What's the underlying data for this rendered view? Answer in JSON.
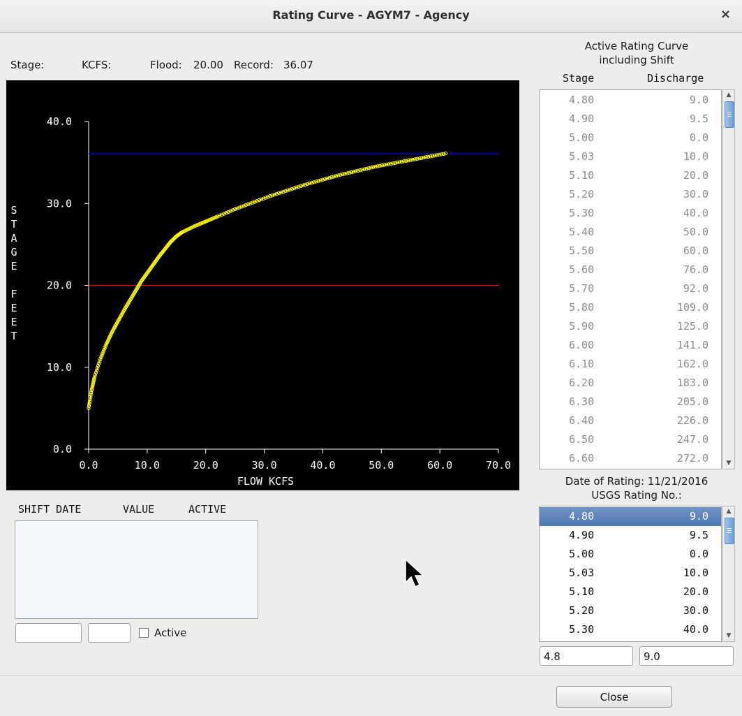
{
  "window": {
    "title": "Rating Curve - AGYM7 - Agency",
    "close_glyph": "×"
  },
  "info_bar": {
    "stage_label": "Stage:",
    "kcfs_label": "KCFS:",
    "flood_label": "Flood:",
    "flood_value": "20.00",
    "record_label": "Record:",
    "record_value": "36.07"
  },
  "chart_data": {
    "type": "line",
    "xlabel": "FLOW KCFS",
    "ylabel": "STAGE FEET",
    "xlim": [
      0,
      70
    ],
    "ylim": [
      0,
      40
    ],
    "x_ticks": [
      "0.0",
      "10.0",
      "20.0",
      "30.0",
      "40.0",
      "50.0",
      "60.0",
      "70.0"
    ],
    "y_ticks": [
      "0.0",
      "10.0",
      "20.0",
      "30.0",
      "40.0"
    ],
    "series": [
      {
        "color": "#ffff00",
        "marker": "circle",
        "x": [
          0,
          0.5,
          1.0,
          2.0,
          3.0,
          4.0,
          5.0,
          6.0,
          7.0,
          8.0,
          9.0,
          10.0,
          11.0,
          12.0,
          13.0,
          14.0,
          15.0,
          16.0,
          18.0,
          20.0,
          22.0,
          25.0,
          28.0,
          31.0,
          34.0,
          37.0,
          40.0,
          43.0,
          46.0,
          49.0,
          52.0,
          55.0,
          58.0,
          61.0
        ],
        "y": [
          5.0,
          7.2,
          8.8,
          11.0,
          12.8,
          14.3,
          15.6,
          16.9,
          18.1,
          19.3,
          20.5,
          21.5,
          22.5,
          23.5,
          24.4,
          25.3,
          26.0,
          26.5,
          27.2,
          27.8,
          28.4,
          29.3,
          30.1,
          30.9,
          31.6,
          32.3,
          32.9,
          33.5,
          34.0,
          34.5,
          34.9,
          35.3,
          35.7,
          36.1
        ]
      }
    ],
    "reference_lines": [
      {
        "name": "Record",
        "y": 36.07,
        "color": "#0000ff"
      },
      {
        "name": "Flood",
        "y": 20.0,
        "color": "#ff0000"
      }
    ]
  },
  "active_curve": {
    "title_line1": "Active Rating Curve",
    "title_line2": "including Shift",
    "col_stage": "Stage",
    "col_discharge": "Discharge",
    "rows": [
      [
        "4.80",
        "9.0"
      ],
      [
        "4.90",
        "9.5"
      ],
      [
        "5.00",
        "0.0"
      ],
      [
        "5.03",
        "10.0"
      ],
      [
        "5.10",
        "20.0"
      ],
      [
        "5.20",
        "30.0"
      ],
      [
        "5.30",
        "40.0"
      ],
      [
        "5.40",
        "50.0"
      ],
      [
        "5.50",
        "60.0"
      ],
      [
        "5.60",
        "76.0"
      ],
      [
        "5.70",
        "92.0"
      ],
      [
        "5.80",
        "109.0"
      ],
      [
        "5.90",
        "125.0"
      ],
      [
        "6.00",
        "141.0"
      ],
      [
        "6.10",
        "162.0"
      ],
      [
        "6.20",
        "183.0"
      ],
      [
        "6.30",
        "205.0"
      ],
      [
        "6.40",
        "226.0"
      ],
      [
        "6.50",
        "247.0"
      ],
      [
        "6.60",
        "272.0"
      ]
    ]
  },
  "usgs_rating": {
    "date_line": "Date of Rating: 11/21/2016",
    "rating_no_line": "USGS Rating No.:",
    "rows": [
      [
        "4.80",
        "9.0"
      ],
      [
        "4.90",
        "9.5"
      ],
      [
        "5.00",
        "0.0"
      ],
      [
        "5.03",
        "10.0"
      ],
      [
        "5.10",
        "20.0"
      ],
      [
        "5.20",
        "30.0"
      ],
      [
        "5.30",
        "40.0"
      ]
    ],
    "selected_index": 0,
    "stage_input": "4.8",
    "discharge_input": "9.0"
  },
  "shift": {
    "col_date": "SHIFT DATE",
    "col_value": "VALUE",
    "col_active": "ACTIVE",
    "date_input": "",
    "value_input": "",
    "active_label": "Active"
  },
  "footer": {
    "close_label": "Close"
  }
}
